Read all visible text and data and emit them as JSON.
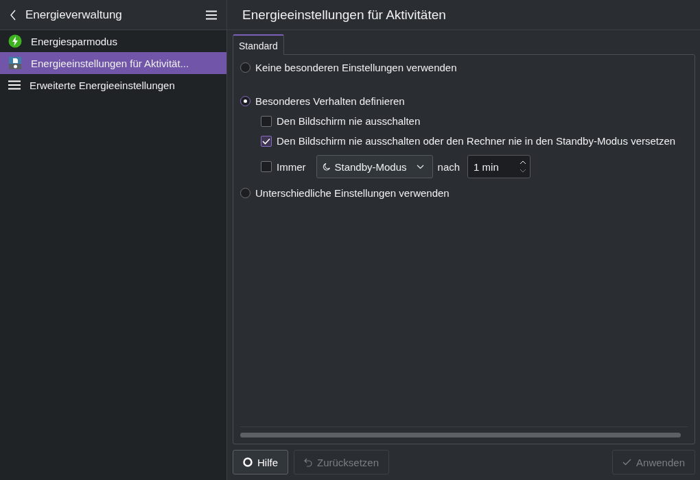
{
  "sidebar": {
    "title": "Energieverwaltung",
    "items": [
      {
        "label": "Energiesparmodus",
        "kind": "bolt",
        "selected": false
      },
      {
        "label": "Energieeinstellungen für Aktivität...",
        "kind": "activity",
        "selected": true
      },
      {
        "label": "Erweiterte Energieeinstellungen",
        "kind": "lines",
        "selected": false
      }
    ]
  },
  "page": {
    "title": "Energieeinstellungen für Aktivitäten",
    "tabs": [
      {
        "label": "Standard",
        "selected": true
      }
    ],
    "options": [
      {
        "label": "Keine besonderen Einstellungen verwenden",
        "selected": false
      },
      {
        "label": "Besonderes Verhalten definieren",
        "selected": true,
        "children": [
          {
            "kind": "checkbox",
            "label": "Den Bildschirm nie ausschalten",
            "checked": false
          },
          {
            "kind": "checkbox",
            "label": "Den Bildschirm nie ausschalten oder den Rechner nie in den Standby-Modus versetzen",
            "checked": true
          },
          {
            "kind": "timer",
            "label": "Immer",
            "checked": false,
            "action": "Standby-Modus",
            "after": "nach",
            "duration": "1 min"
          }
        ]
      },
      {
        "label": "Unterschiedliche Einstellungen verwenden",
        "selected": false
      }
    ]
  },
  "buttons": [
    {
      "label": "Hilfe",
      "kind": "help",
      "disabled": false
    },
    {
      "label": "Zurücksetzen",
      "kind": "reset",
      "disabled": true
    },
    {
      "label": "Anwenden",
      "kind": "apply",
      "disabled": true
    }
  ]
}
